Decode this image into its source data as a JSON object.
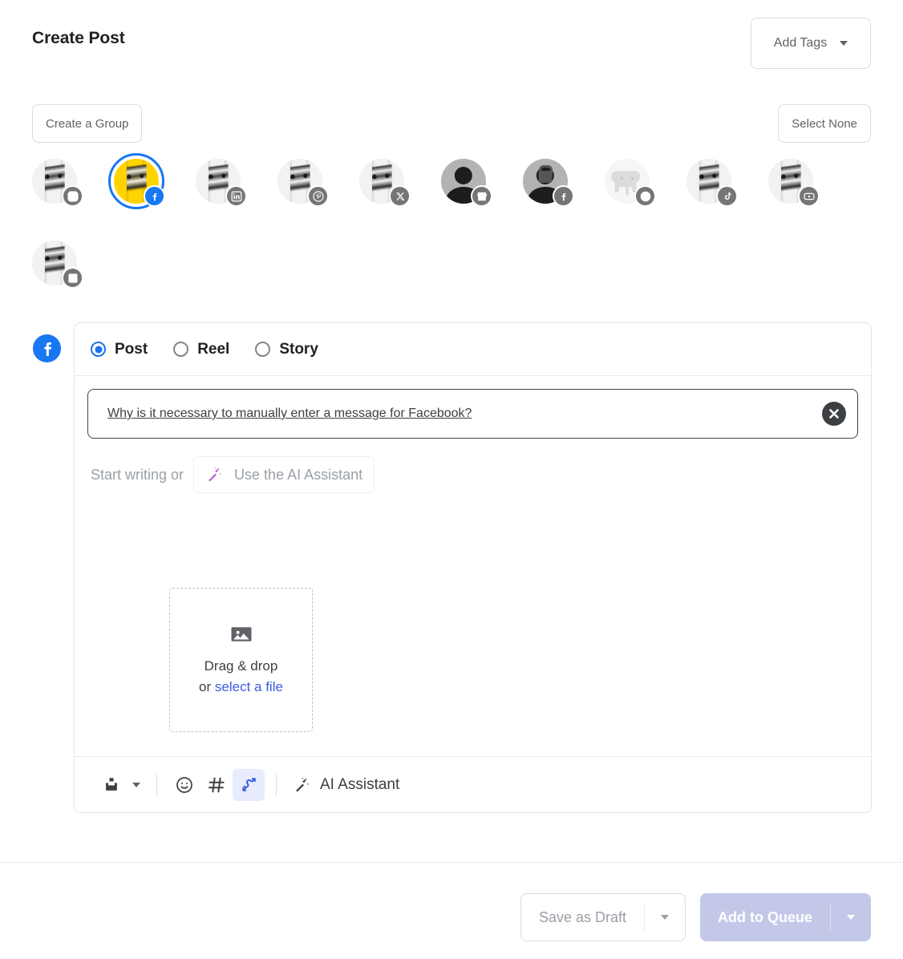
{
  "header": {
    "title": "Create Post",
    "add_tags_label": "Add Tags",
    "add_tags_icon": "chevron-down-icon"
  },
  "group_row": {
    "create_group_label": "Create a Group",
    "select_none_label": "Select None"
  },
  "accounts": [
    {
      "network": "instagram",
      "selected": false,
      "avatar": "shoes-photo",
      "dim": false
    },
    {
      "network": "facebook",
      "selected": true,
      "avatar": "shoes-photo",
      "dim": false
    },
    {
      "network": "linkedin",
      "selected": false,
      "avatar": "shoes-photo",
      "dim": false
    },
    {
      "network": "pinterest",
      "selected": false,
      "avatar": "shoes-photo",
      "dim": false
    },
    {
      "network": "x-twitter",
      "selected": false,
      "avatar": "shoes-photo",
      "dim": false
    },
    {
      "network": "google-business",
      "selected": false,
      "avatar": "person",
      "dim": false
    },
    {
      "network": "facebook-group",
      "selected": false,
      "avatar": "person-locked",
      "dim": false
    },
    {
      "network": "mastodon",
      "selected": false,
      "avatar": "elephant",
      "dim": true
    },
    {
      "network": "tiktok",
      "selected": false,
      "avatar": "shoes-photo",
      "dim": false
    },
    {
      "network": "youtube",
      "selected": false,
      "avatar": "shoes-photo",
      "dim": false
    },
    {
      "network": "blog",
      "selected": false,
      "avatar": "shoes-photo",
      "dim": false
    }
  ],
  "composer": {
    "channel_icon": "facebook-icon",
    "post_types": [
      {
        "label": "Post",
        "selected": true
      },
      {
        "label": "Reel",
        "selected": false
      },
      {
        "label": "Story",
        "selected": false
      }
    ],
    "notice": {
      "text": "Why is it necessary to manually enter a message for Facebook?",
      "close_icon": "close-icon"
    },
    "write_placeholder": "Start writing or",
    "ai_chip_label": "Use the AI Assistant",
    "ai_chip_icon": "magic-wand-icon",
    "dropzone": {
      "icon": "image-icon",
      "line1": "Drag & drop",
      "line2_prefix": "or ",
      "line2_link": "select a file"
    },
    "toolbar": {
      "upload_icon": "upload-tray-icon",
      "upload_caret_icon": "chevron-down-icon",
      "emoji_icon": "emoji-icon",
      "hashtag_icon": "hashtag-icon",
      "link_shortener_icon": "link-shortener-icon",
      "link_shortener_active": true,
      "ai_assistant_label": "AI Assistant",
      "ai_assistant_icon": "magic-wand-icon"
    }
  },
  "footer": {
    "save_draft_label": "Save as Draft",
    "save_draft_caret_icon": "chevron-down-icon",
    "add_to_queue_label": "Add to Queue",
    "add_to_queue_caret_icon": "chevron-down-icon"
  },
  "colors": {
    "facebook_blue": "#1877f2",
    "selected_ring": "#1877f2",
    "radio_blue": "#1a73e8",
    "link_blue": "#3b5ce0",
    "ai_purple": "#bb6bd9",
    "link_shortener_blue": "#3b5ce0",
    "primary_button_bg": "#c3c8e8",
    "selected_avatar_bg": "#ffd400"
  }
}
